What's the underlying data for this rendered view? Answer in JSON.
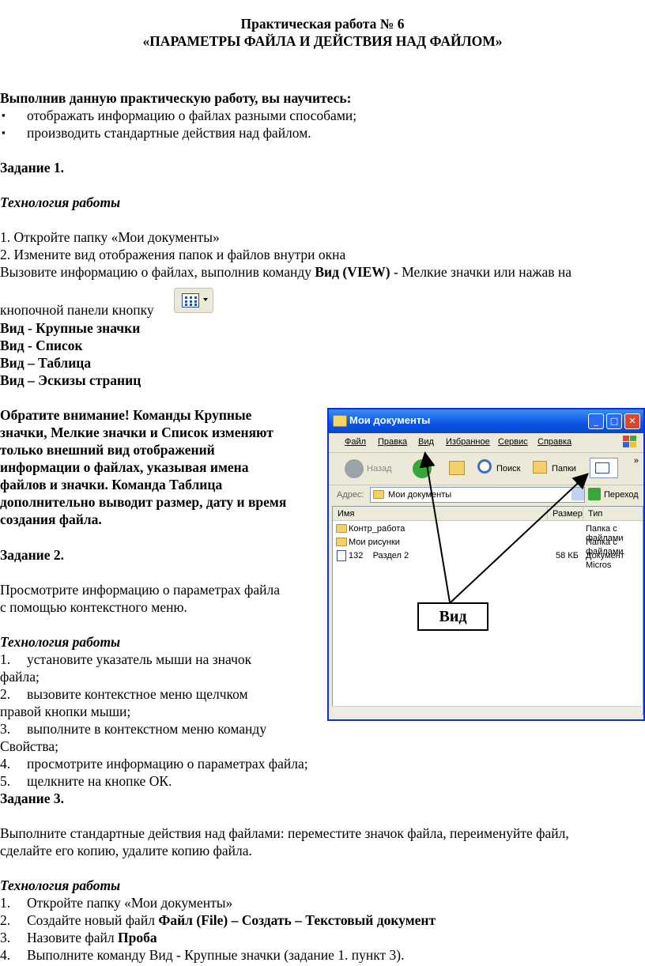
{
  "title": {
    "line1": "Практическая работа № 6",
    "line2": "«ПАРАМЕТРЫ ФАЙЛА И ДЕЙСТВИЯ НАД ФАЙЛОМ»"
  },
  "intro": {
    "heading": "Выполнив данную практическую работу, вы научитесь:",
    "bullets": [
      "отображать информацию о файлах разными способами;",
      "производить стандартные действия над файлом."
    ]
  },
  "task1": {
    "heading": "Задание 1.",
    "tech": "Технология работы",
    "step1": "1. Откройте папку «Мои документы»",
    "step2": "2. Измените вид отображения папок и файлов внутри окна",
    "line3_a": "Вызовите информацию о файлах, выполнив команду ",
    "line3_b": "Вид (VIEW)",
    "line3_c": " - Мелкие значки или нажав на",
    "line4": "кнопочной панели кнопку",
    "views": [
      "Вид - Крупные значки",
      "Вид - Список",
      "Вид – Таблица",
      "Вид – Эскизы страниц"
    ],
    "note": [
      "Обратите внимание! Команды Крупные",
      "значки, Мелкие значки и Список изменяют",
      "только внешний вид отображений",
      "информации о файлах, указывая имена",
      "файлов и значки. Команда Таблица",
      "дополнительно выводит размер, дату и время",
      "создания файла."
    ]
  },
  "task2": {
    "heading": "Задание 2.",
    "desc": [
      "Просмотрите информацию о параметрах файла",
      "с помощью контекстного меню."
    ],
    "tech": "Технология работы",
    "steps": [
      {
        "n": "1.",
        "text": "установите указатель мыши на значок",
        "cont": "файла;"
      },
      {
        "n": "2.",
        "text": "вызовите контекстное меню щелчком",
        "cont": "правой кнопки мыши;"
      },
      {
        "n": "3.",
        "text": "выполните в контекстном меню команду",
        "cont": "Свойства;"
      },
      {
        "n": "4.",
        "text": "просмотрите информацию о параметрах файла;",
        "cont": ""
      },
      {
        "n": "5.",
        "text": "щелкните на кнопке ОК.",
        "cont": ""
      }
    ]
  },
  "task3": {
    "heading": "Задание 3.",
    "desc": [
      "Выполните стандартные действия над файлами: переместите значок файла, переименуйте файл,",
      "сделайте его копию, удалите копию файла."
    ],
    "tech": "Технология работы",
    "s1": "Откройте папку «Мои документы»",
    "s2a": "Создайте новый файл ",
    "s2b": "Файл (File) – Создать – Текстовый документ",
    "s3a": "Назовите файл ",
    "s3b": "Проба",
    "s4": "Выполните команду Вид - Крупные значки (задание 1. пункт 3).",
    "nums": [
      "1.",
      "2.",
      "3.",
      "4."
    ]
  },
  "explorer": {
    "title": "Мои документы",
    "menu": [
      "Файл",
      "Правка",
      "Вид",
      "Избранное",
      "Сервис",
      "Справка"
    ],
    "back": "Назад",
    "search": "Поиск",
    "folders": "Папки",
    "address_label": "Адрес:",
    "address": "Мои документы",
    "go": "Переход",
    "columns": [
      "Имя",
      "Размер",
      "Тип"
    ],
    "rows": [
      {
        "name": "Контр_работа",
        "size": "",
        "type": "Папка с файлами"
      },
      {
        "name": "Мои рисунки",
        "size": "",
        "type": "Папка с файлами"
      },
      {
        "name": "132    Раздел 2",
        "size": "58 КБ",
        "type": "Документ Micros"
      }
    ],
    "callout": "Вид"
  }
}
